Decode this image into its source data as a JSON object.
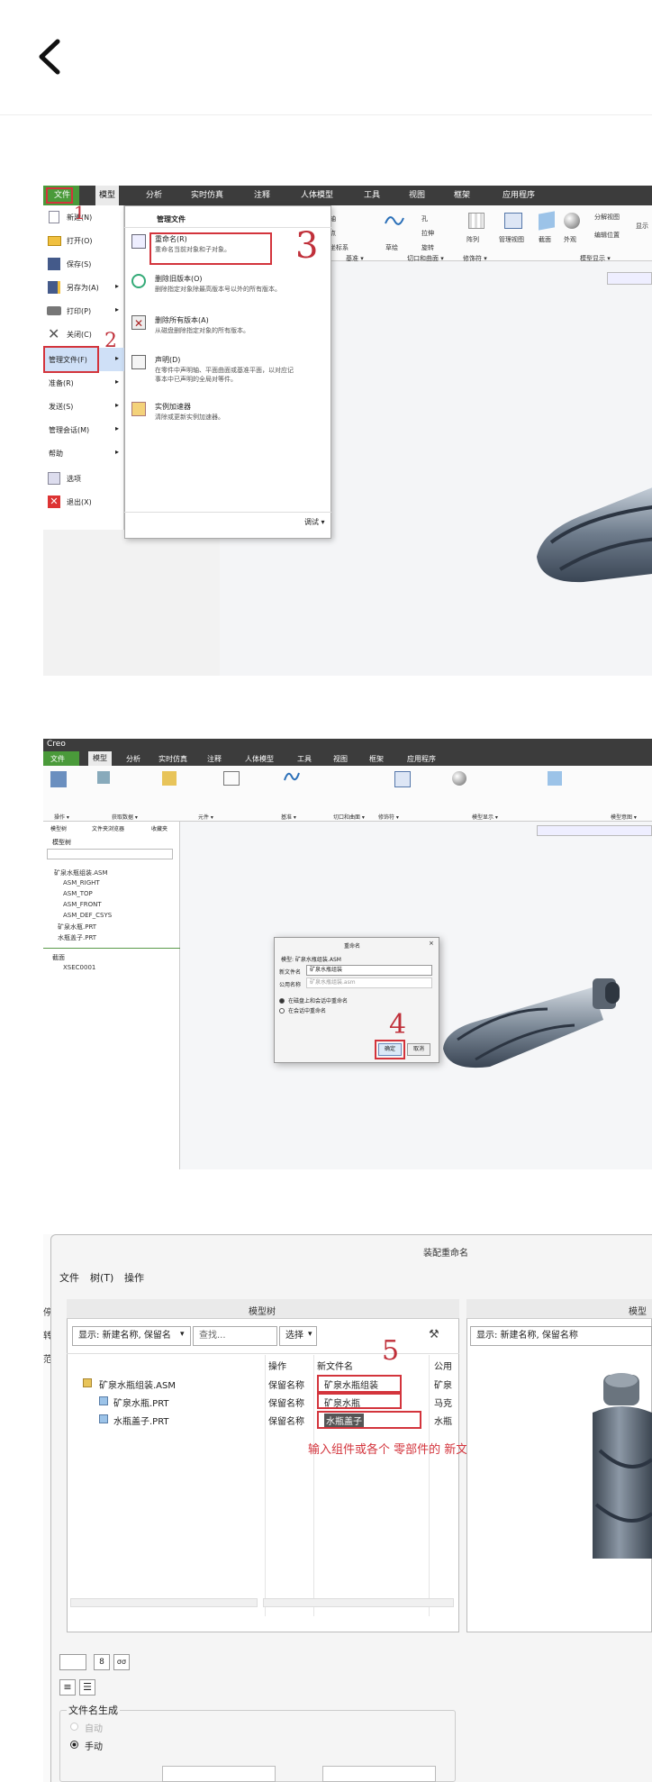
{
  "nav": {
    "back_label": "back"
  },
  "panel1": {
    "tabs": [
      "文件",
      "模型",
      "分析",
      "实时仿真",
      "注释",
      "人体模型",
      "工具",
      "视图",
      "框架",
      "应用程序"
    ],
    "file_menu": [
      "新建(N)",
      "打开(O)",
      "保存(S)",
      "另存为(A)",
      "打印(P)",
      "关闭(C)",
      "管理文件(F)",
      "准备(R)",
      "发送(S)",
      "管理会话(M)",
      "帮助",
      "选项",
      "退出(X)"
    ],
    "submenu_title": "管理文件",
    "submenu": [
      {
        "title": "重命名(R)",
        "desc": "重命名当前对象和子对象。"
      },
      {
        "title": "删除旧版本(O)",
        "desc": "删除指定对象除最高版本号以外的所有版本。"
      },
      {
        "title": "删除所有版本(A)",
        "desc": "从磁盘删除指定对象的所有版本。"
      },
      {
        "title": "声明(D)",
        "desc": "在零件中声明轴、平面曲面或基准平面，以对应记事本中已声明的全局对等件。"
      },
      {
        "title": "实例加速器",
        "desc": "清除或更新实例加速器。"
      }
    ],
    "debug_label": "调试 ▾",
    "ribbon_items": [
      "轴",
      "点",
      "坐标系",
      "草绘",
      "孔",
      "拉伸",
      "旋转",
      "阵列",
      "管理视图",
      "截面",
      "外观",
      "分解视图",
      "编辑位置",
      "显示"
    ],
    "ribbon_groups": [
      "基准 ▾",
      "切口和曲面 ▾",
      "修饰符 ▾",
      "模型显示 ▾"
    ],
    "annotations": [
      "1",
      "2",
      "3"
    ]
  },
  "panel2": {
    "app_label": "Creo",
    "tabs": [
      "文件",
      "模型",
      "分析",
      "实时仿真",
      "注释",
      "人体模型",
      "工具",
      "视图",
      "框架",
      "应用程序"
    ],
    "ribbon_groups": [
      "操作 ▾",
      "获取数据 ▾",
      "元件 ▾",
      "基准 ▾",
      "切口和曲面 ▾",
      "修饰符 ▾",
      "模型显示 ▾",
      "模型意图 ▾"
    ],
    "nav_tabs": [
      "模型树",
      "文件夹浏览器",
      "收藏夹"
    ],
    "tree_title": "模型树",
    "tree": [
      "矿泉水瓶组装.ASM",
      "ASM_RIGHT",
      "ASM_TOP",
      "ASM_FRONT",
      "ASM_DEF_CSYS",
      "矿泉水瓶.PRT",
      "水瓶盖子.PRT"
    ],
    "tree2_title": "截面",
    "tree2_item": "XSEC0001",
    "dialog": {
      "title": "重命名",
      "model_label": "模型: 矿泉水瓶组装.ASM",
      "new_name_label": "新文件名",
      "new_name_value": "矿泉水瓶组装",
      "common_label": "公用名称",
      "common_value": "矿泉水瓶组装.asm",
      "radio1": "在磁盘上和会话中重命名",
      "radio2": "在会话中重命名",
      "ok": "确定",
      "cancel": "取消"
    },
    "annotation": "4"
  },
  "panel3": {
    "window_title": "装配重命名",
    "menu": [
      "文件",
      "树(T)",
      "操作"
    ],
    "tree_panel_title": "模型树",
    "right_panel_title": "模型",
    "display_select": "显示: 新建名称, 保留名",
    "right_display_select": "显示: 新建名称, 保留名称",
    "search_placeholder": "查找...",
    "select_label": "选择",
    "columns": [
      "操作",
      "新文件名",
      "公用"
    ],
    "rows": [
      {
        "name": "矿泉水瓶组装.ASM",
        "op": "保留名称",
        "new": "矿泉水瓶组装",
        "common": "矿泉"
      },
      {
        "name": "矿泉水瓶.PRT",
        "op": "保留名称",
        "new": "矿泉水瓶",
        "common": "马克"
      },
      {
        "name": "水瓶盖子.PRT",
        "op": "保留名称",
        "new": "水瓶盖子",
        "common": "水瓶"
      }
    ],
    "instruction": "输入组件或各个 零部件的 新文件名",
    "annotation": "5",
    "side_chars": [
      "停",
      "转",
      "范"
    ],
    "file_gen_title": "文件名生成",
    "radio_auto": "自动",
    "radio_manual": "手动"
  },
  "colors": {
    "ribbon_green": "#4a9a3a",
    "annotation_red": "#d3343c",
    "dark_bar": "#3c3c3c"
  }
}
